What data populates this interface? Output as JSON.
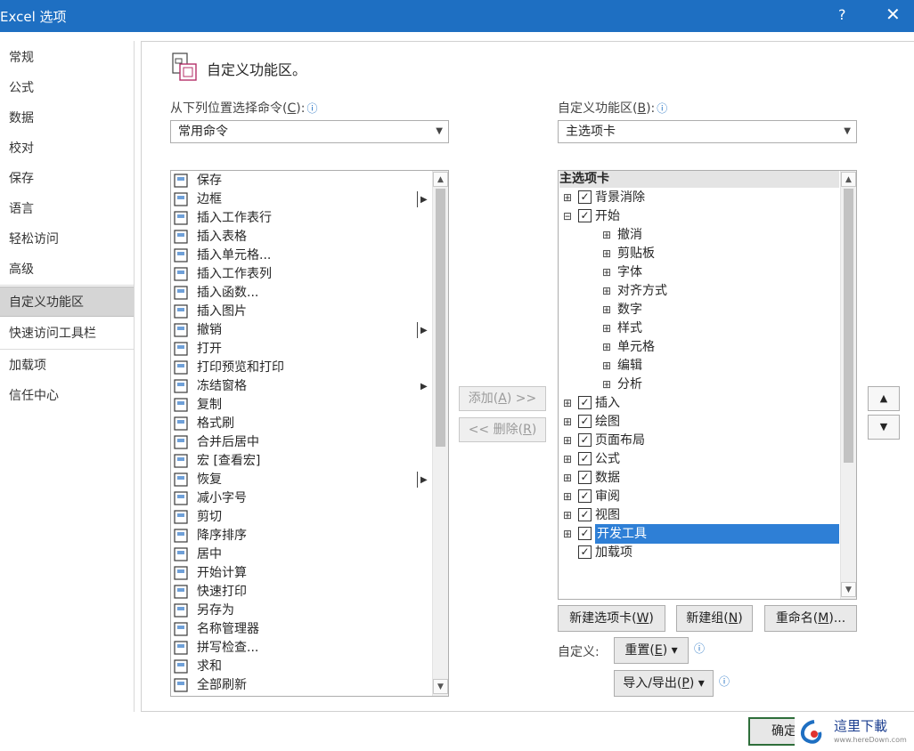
{
  "window": {
    "title": "Excel 选项",
    "help": "?",
    "close": "✕"
  },
  "nav": {
    "items": [
      "常规",
      "公式",
      "数据",
      "校对",
      "保存",
      "语言",
      "轻松访问",
      "高级",
      "自定义功能区",
      "快速访问工具栏",
      "加载项",
      "信任中心"
    ]
  },
  "heading": "自定义功能区。",
  "left": {
    "label_pre": "从下列位置选择命令(",
    "label_key": "C",
    "label_post": "):",
    "dropdown": "常用命令",
    "commands": [
      {
        "label": "保存",
        "icon": "save-icon"
      },
      {
        "label": "边框",
        "icon": "border-icon",
        "sub": "bar"
      },
      {
        "label": "插入工作表行",
        "icon": "insert-rows-icon"
      },
      {
        "label": "插入表格",
        "icon": "insert-table-icon"
      },
      {
        "label": "插入单元格...",
        "icon": "insert-cells-icon"
      },
      {
        "label": "插入工作表列",
        "icon": "insert-columns-icon"
      },
      {
        "label": "插入函数...",
        "icon": "function-icon"
      },
      {
        "label": "插入图片",
        "icon": "picture-icon"
      },
      {
        "label": "撤销",
        "icon": "undo-icon",
        "sub": "bar"
      },
      {
        "label": "打开",
        "icon": "open-folder-icon"
      },
      {
        "label": "打印预览和打印",
        "icon": "print-preview-icon"
      },
      {
        "label": "冻结窗格",
        "icon": "freeze-panes-icon",
        "sub": "arrow"
      },
      {
        "label": "复制",
        "icon": "copy-icon"
      },
      {
        "label": "格式刷",
        "icon": "format-painter-icon"
      },
      {
        "label": "合并后居中",
        "icon": "merge-center-icon"
      },
      {
        "label": "宏 [查看宏]",
        "icon": "macro-icon"
      },
      {
        "label": "恢复",
        "icon": "redo-icon",
        "sub": "bar"
      },
      {
        "label": "减小字号",
        "icon": "decrease-font-icon"
      },
      {
        "label": "剪切",
        "icon": "cut-icon"
      },
      {
        "label": "降序排序",
        "icon": "sort-descending-icon"
      },
      {
        "label": "居中",
        "icon": "center-align-icon"
      },
      {
        "label": "开始计算",
        "icon": "calculate-icon"
      },
      {
        "label": "快速打印",
        "icon": "quick-print-icon"
      },
      {
        "label": "另存为",
        "icon": "save-as-icon"
      },
      {
        "label": "名称管理器",
        "icon": "name-manager-icon"
      },
      {
        "label": "拼写检查...",
        "icon": "spelling-icon"
      },
      {
        "label": "求和",
        "icon": "sum-icon"
      },
      {
        "label": "全部刷新",
        "icon": "refresh-all-icon"
      }
    ]
  },
  "middle": {
    "add_pre": "添加(",
    "add_key": "A",
    "add_post": ") >>",
    "remove_pre": "<< 删除(",
    "remove_key": "R",
    "remove_post": ")"
  },
  "right": {
    "label_pre": "自定义功能区(",
    "label_key": "B",
    "label_post": "):",
    "dropdown": "主选项卡",
    "tree_header": "主选项卡",
    "tree": [
      {
        "label": "背景消除",
        "level": 0,
        "toggle": "⊞",
        "checked": true
      },
      {
        "label": "开始",
        "level": 0,
        "toggle": "⊟",
        "checked": true
      },
      {
        "label": "撤消",
        "level": 1,
        "toggle": "⊞"
      },
      {
        "label": "剪贴板",
        "level": 1,
        "toggle": "⊞"
      },
      {
        "label": "字体",
        "level": 1,
        "toggle": "⊞"
      },
      {
        "label": "对齐方式",
        "level": 1,
        "toggle": "⊞"
      },
      {
        "label": "数字",
        "level": 1,
        "toggle": "⊞"
      },
      {
        "label": "样式",
        "level": 1,
        "toggle": "⊞"
      },
      {
        "label": "单元格",
        "level": 1,
        "toggle": "⊞"
      },
      {
        "label": "编辑",
        "level": 1,
        "toggle": "⊞"
      },
      {
        "label": "分析",
        "level": 1,
        "toggle": "⊞"
      },
      {
        "label": "插入",
        "level": 0,
        "toggle": "⊞",
        "checked": true
      },
      {
        "label": "绘图",
        "level": 0,
        "toggle": "⊞",
        "checked": true
      },
      {
        "label": "页面布局",
        "level": 0,
        "toggle": "⊞",
        "checked": true
      },
      {
        "label": "公式",
        "level": 0,
        "toggle": "⊞",
        "checked": true
      },
      {
        "label": "数据",
        "level": 0,
        "toggle": "⊞",
        "checked": true
      },
      {
        "label": "审阅",
        "level": 0,
        "toggle": "⊞",
        "checked": true
      },
      {
        "label": "视图",
        "level": 0,
        "toggle": "⊞",
        "checked": true
      },
      {
        "label": "开发工具",
        "level": 0,
        "toggle": "⊞",
        "checked": true,
        "selected": true
      },
      {
        "label": "加载项",
        "level": 0,
        "toggle": "",
        "checked": true
      }
    ],
    "new_tab_pre": "新建选项卡(",
    "new_tab_key": "W",
    "new_tab_post": ")",
    "new_group_pre": "新建组(",
    "new_group_key": "N",
    "new_group_post": ")",
    "rename_pre": "重命名(",
    "rename_key": "M",
    "rename_post": ")...",
    "customize_label": "自定义:",
    "reset_pre": "重置(",
    "reset_key": "E",
    "reset_post": ") ▾",
    "import_pre": "导入/导出(",
    "import_key": "P",
    "import_post": ") ▾"
  },
  "footer": {
    "ok": "确定"
  },
  "colors": {
    "titlebar": "#1e6fc2",
    "selection": "#2e7fd6"
  }
}
